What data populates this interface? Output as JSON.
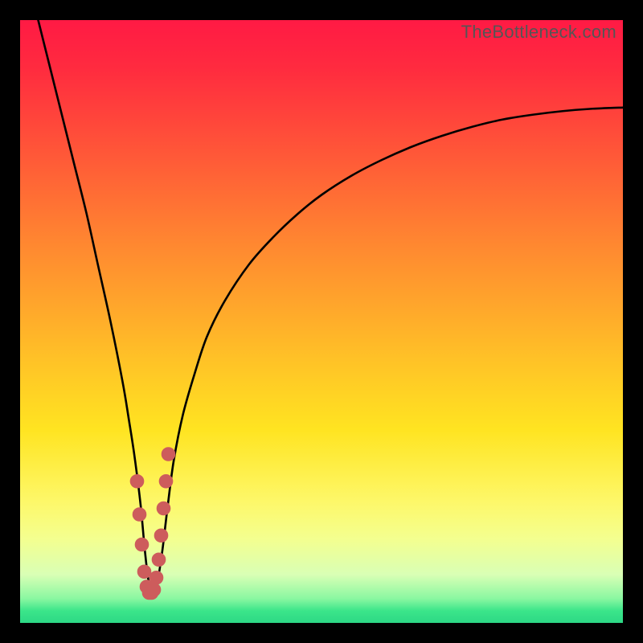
{
  "watermark": "TheBottleneck.com",
  "colors": {
    "curve": "#000000",
    "marker_fill": "#cd5c5c",
    "marker_stroke": "#cd5c5c"
  },
  "chart_data": {
    "type": "line",
    "title": "",
    "xlabel": "",
    "ylabel": "",
    "xlim": [
      0,
      100
    ],
    "ylim": [
      0,
      100
    ],
    "series": [
      {
        "name": "bottleneck-curve",
        "x": [
          3,
          5,
          7,
          9,
          11,
          13,
          15,
          17,
          18,
          19,
          20,
          20.7,
          21.3,
          22,
          22.8,
          23.6,
          24.5,
          25.5,
          27,
          29,
          31,
          34,
          38,
          42,
          46,
          50,
          55,
          60,
          65,
          70,
          75,
          80,
          85,
          90,
          95,
          100
        ],
        "y": [
          100,
          92,
          84,
          76,
          68,
          59,
          50,
          40,
          34,
          27.5,
          19.5,
          12,
          7,
          5,
          7,
          12,
          19.5,
          27,
          34.5,
          41.5,
          47.5,
          53.5,
          59.5,
          64,
          67.8,
          71,
          74.2,
          76.8,
          79,
          80.8,
          82.3,
          83.5,
          84.3,
          84.9,
          85.3,
          85.5
        ]
      }
    ],
    "markers": {
      "name": "highlight-points",
      "x": [
        19.4,
        19.8,
        20.2,
        20.6,
        21.0,
        21.4,
        21.8,
        22.2,
        22.6,
        23.0,
        23.4,
        23.8,
        24.2,
        24.6
      ],
      "y": [
        23.5,
        18,
        13,
        8.5,
        6,
        5,
        5,
        5.5,
        7.5,
        10.5,
        14.5,
        19,
        23.5,
        28
      ],
      "r": 1.1
    }
  }
}
